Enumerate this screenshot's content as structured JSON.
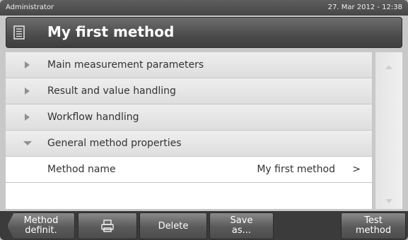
{
  "status": {
    "user": "Administrator",
    "datetime": "27. Mar 2012 - 12:38"
  },
  "header": {
    "title": "My first method",
    "icon": "method-list-icon"
  },
  "list": {
    "sections": [
      {
        "label": "Main measurement parameters",
        "expanded": false
      },
      {
        "label": "Result and value handling",
        "expanded": false
      },
      {
        "label": "Workflow handling",
        "expanded": false
      },
      {
        "label": "General method properties",
        "expanded": true
      }
    ],
    "properties": [
      {
        "label": "Method name",
        "value": "My first method",
        "chevron": ">"
      }
    ]
  },
  "toolbar": {
    "back_label": "Method\ndefinit.",
    "print_icon": "print-icon",
    "delete_label": "Delete",
    "save_label": "Save\nas...",
    "test_label": "Test\nmethod"
  },
  "colors": {
    "header_bg": "#4c4c4c",
    "list_bg": "#f4f4f4",
    "toolbar_bg": "#3b3b3b"
  }
}
